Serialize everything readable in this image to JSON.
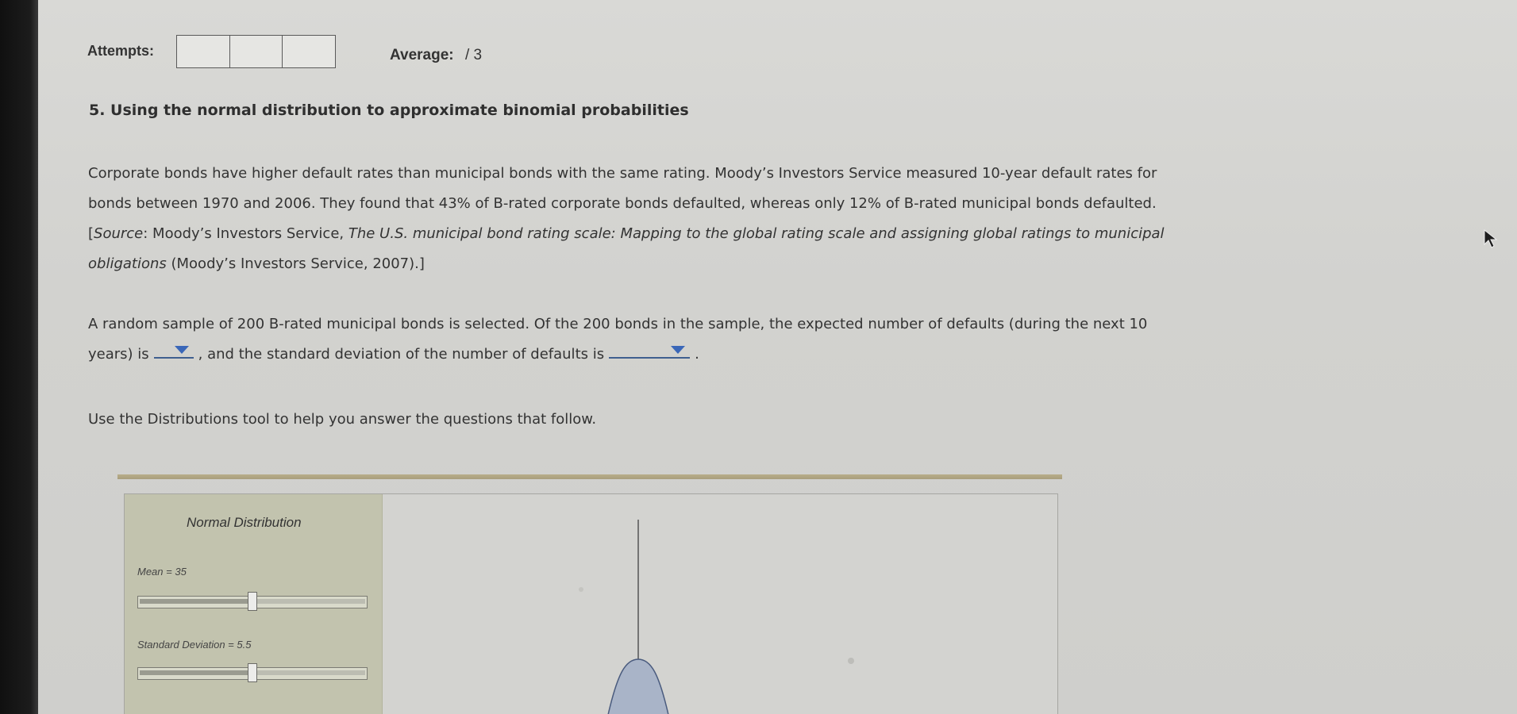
{
  "attempts": {
    "label": "Attempts:",
    "box_count": 3
  },
  "average": {
    "label": "Average:",
    "value": "/ 3"
  },
  "question": {
    "title": "5. Using the normal distribution to approximate binomial probabilities",
    "p1_line1": "Corporate bonds have higher default rates than municipal bonds with the same rating. Moody’s Investors Service measured 10-year default rates for",
    "p1_line2": "bonds between 1970 and 2006. They found that 43% of B-rated corporate bonds defaulted, whereas only 12% of B-rated municipal bonds defaulted.",
    "p1_line3_open": "[",
    "p1_line3_source": "Source",
    "p1_line3_mid": ": Moody’s Investors Service, ",
    "p1_line3_title": "The U.S. municipal bond rating scale: Mapping to the global rating scale and assigning global ratings to municipal",
    "p1_line4_title": "obligations",
    "p1_line4_rest": " (Moody’s Investors Service, 2007).]",
    "p2_line1": "A random sample of 200 B-rated municipal bonds is selected. Of the 200 bonds in the sample, the expected number of defaults (during the next 10",
    "p2_line2_a": "years) is",
    "p2_line2_b": ", and the standard deviation of the number of defaults is",
    "p2_line2_c": ".",
    "p3": "Use the Distributions tool to help you answer the questions that follow."
  },
  "dropdowns": {
    "expected_defaults": "",
    "std_dev_defaults": ""
  },
  "tool": {
    "panel_title": "Normal Distribution",
    "mean_label": "Mean = 35",
    "sd_label": "Standard Deviation = 5.5",
    "mean_slider_level": 0.5,
    "sd_slider_level": 0.5
  },
  "colors": {
    "dropdown_arrow": "#3a67b8",
    "curve_fill": "#a9b4c8",
    "curve_stroke": "#4a5b7e",
    "panel_bg": "#c2c3ae"
  },
  "icons": {
    "cursor": "mouse-pointer-icon",
    "dropdown": "triangle-down-icon"
  }
}
